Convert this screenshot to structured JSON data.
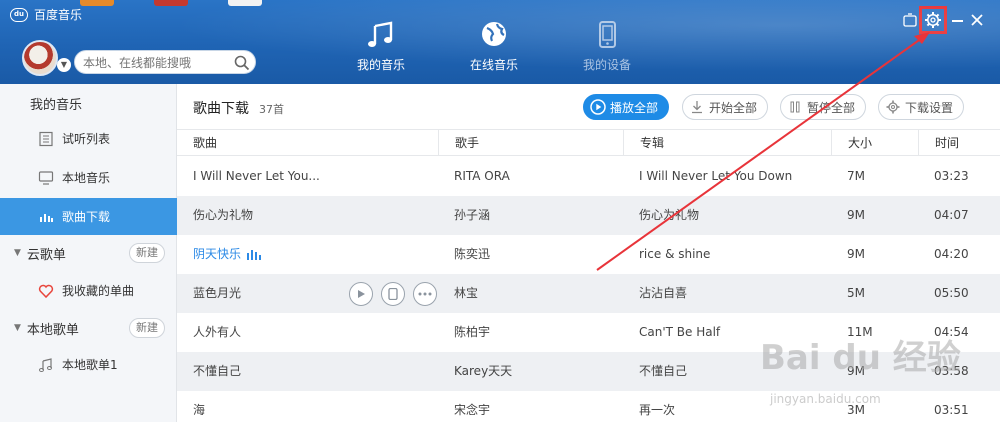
{
  "app": {
    "title": "百度音乐",
    "logo": "du"
  },
  "search": {
    "placeholder": "本地、在线都能搜哦"
  },
  "nav": [
    {
      "label": "我的音乐",
      "icon": "music-note-icon"
    },
    {
      "label": "在线音乐",
      "icon": "globe-icon"
    },
    {
      "label": "我的设备",
      "icon": "device-icon"
    }
  ],
  "sidebar": {
    "header": "我的音乐",
    "items": [
      {
        "label": "试听列表",
        "icon": "list-icon"
      },
      {
        "label": "本地音乐",
        "icon": "monitor-icon"
      },
      {
        "label": "歌曲下载",
        "icon": "download-bars-icon"
      }
    ],
    "cloud": {
      "label": "云歌单",
      "new": "新建"
    },
    "favorites": {
      "label": "我收藏的单曲",
      "icon": "heart-icon"
    },
    "local": {
      "label": "本地歌单",
      "new": "新建"
    },
    "local_item": {
      "label": "本地歌单1",
      "icon": "music-note-icon"
    }
  },
  "main": {
    "title": "歌曲下载",
    "count": "37首",
    "buttons": {
      "play_all": "播放全部",
      "start_all": "开始全部",
      "pause_all": "暂停全部",
      "settings": "下载设置"
    },
    "columns": [
      "歌曲",
      "歌手",
      "专辑",
      "大小",
      "时间"
    ],
    "rows": [
      {
        "song": "I Will Never Let You...",
        "artist": "RITA ORA",
        "album": "I Will Never Let You Down",
        "size": "7M",
        "time": "03:23"
      },
      {
        "song": "伤心为礼物",
        "artist": "孙子涵",
        "album": "伤心为礼物",
        "size": "9M",
        "time": "04:07"
      },
      {
        "song": "阴天快乐",
        "artist": "陈奕迅",
        "album": "rice & shine",
        "size": "9M",
        "time": "04:20"
      },
      {
        "song": "蓝色月光",
        "artist": "林宝",
        "album": "沾沾自喜",
        "size": "5M",
        "time": "05:50"
      },
      {
        "song": "人外有人",
        "artist": "陈柏宇",
        "album": "Can'T Be Half",
        "size": "11M",
        "time": "04:54"
      },
      {
        "song": "不懂自己",
        "artist": "Karey天天",
        "album": "不懂自己",
        "size": "9M",
        "time": "03:58"
      },
      {
        "song": "海",
        "artist": "宋念宇",
        "album": "再一次",
        "size": "3M",
        "time": "03:51"
      }
    ]
  },
  "watermark": {
    "text": "Bai du 经验",
    "url": "jingyan.baidu.com"
  },
  "colors": {
    "accent": "#1e8be6",
    "highlight": "#e8262a",
    "header": "#1f64b4"
  }
}
